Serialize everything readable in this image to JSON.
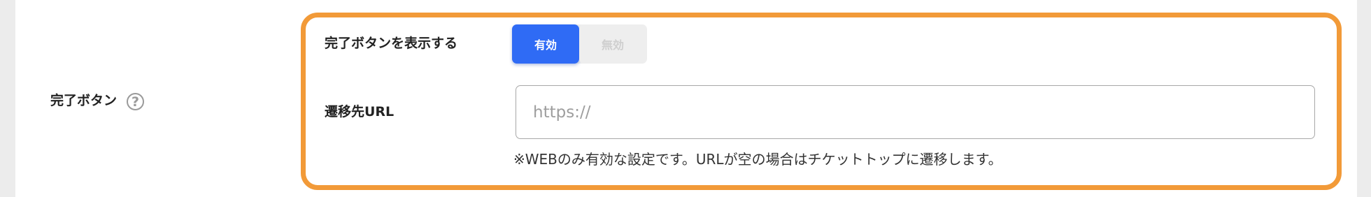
{
  "setting_row": {
    "label": "完了ボタン",
    "help_icon_glyph": "?"
  },
  "show_button_field": {
    "label": "完了ボタンを表示する",
    "options": {
      "enabled": "有効",
      "disabled": "無効"
    },
    "selected": "有効"
  },
  "redirect_url_field": {
    "label": "遷移先URL",
    "value": "",
    "placeholder": "https://",
    "note": "※WEBのみ有効な設定です。URLが空の場合はチケットトップに遷移します。"
  },
  "colors": {
    "highlight_border": "#f29a38",
    "toggle_active": "#2f6bf5",
    "toggle_inactive_bg": "#eeeeee",
    "page_background": "#ececec"
  }
}
